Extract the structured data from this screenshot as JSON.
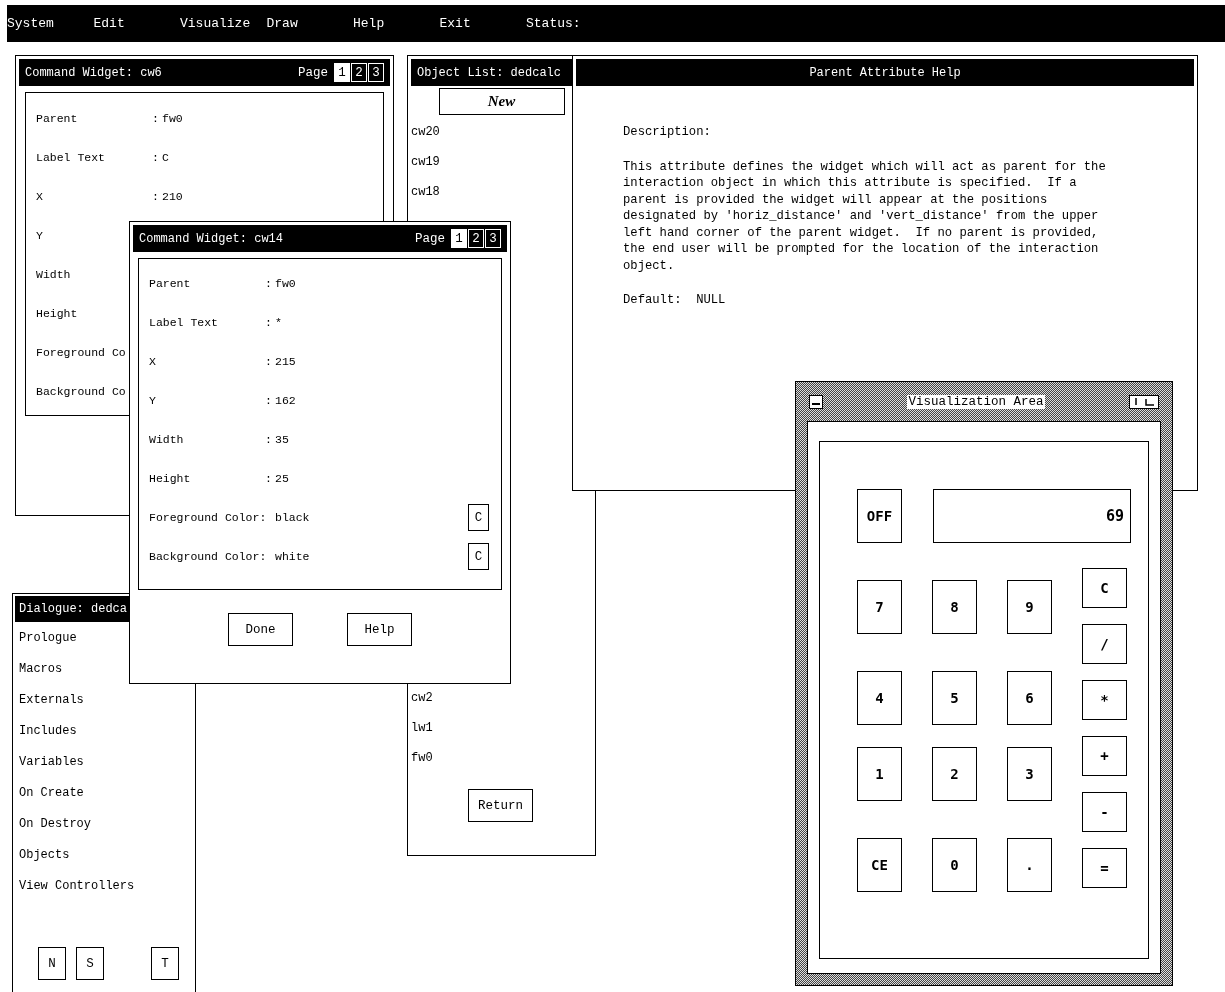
{
  "menu_bar": {
    "items": [
      "System",
      "Edit",
      "Visualize",
      "Draw",
      "Help",
      "Exit"
    ],
    "status_label": "Status:"
  },
  "command_widgets": [
    {
      "title": "Command Widget: cw6",
      "page_label": "Page",
      "pages": [
        {
          "label": "1",
          "selected": true
        },
        {
          "label": "2",
          "selected": false
        },
        {
          "label": "3",
          "selected": false
        }
      ],
      "fields": [
        {
          "label": "Parent",
          "separator": ":",
          "value": "fw0"
        },
        {
          "label": "Label Text",
          "separator": ":",
          "value": "C"
        },
        {
          "label": "X",
          "separator": ":",
          "value": "210"
        },
        {
          "label": "Y"
        },
        {
          "label": "Width"
        },
        {
          "label": "Height"
        },
        {
          "label": "Foreground Co"
        },
        {
          "label": "Background Co"
        }
      ]
    },
    {
      "title": "Command Widget: cw14",
      "page_label": "Page",
      "pages": [
        {
          "label": "1",
          "selected": true
        },
        {
          "label": "2",
          "selected": false
        },
        {
          "label": "3",
          "selected": false
        }
      ],
      "fields": [
        {
          "label": "Parent",
          "separator": ":",
          "value": "fw0"
        },
        {
          "label": "Label Text",
          "separator": ":",
          "value": "*"
        },
        {
          "label": "X",
          "separator": ":",
          "value": "215"
        },
        {
          "label": "Y",
          "separator": ":",
          "value": "162"
        },
        {
          "label": "Width",
          "separator": ":",
          "value": "35"
        },
        {
          "label": "Height",
          "separator": ":",
          "value": "25"
        },
        {
          "label": "Foreground Color:",
          "value": "black",
          "button": "C"
        },
        {
          "label": "Background Color:",
          "value": "white",
          "button": "C"
        }
      ],
      "buttons": [
        "Done",
        "Help"
      ]
    }
  ],
  "object_list": {
    "title": "Object List: dedcalc",
    "new_button": "New",
    "items_top": [
      "cw20",
      "cw19",
      "cw18"
    ],
    "items_bottom": [
      "cw2",
      "lw1",
      "fw0"
    ],
    "return_button": "Return"
  },
  "help": {
    "title": "Parent Attribute Help",
    "heading": "Description:",
    "body": "This attribute defines the widget which will act as parent for the\ninteraction object in which this attribute is specified.  If a\nparent is provided the widget will appear at the positions\ndesignated by 'horiz_distance' and 'vert_distance' from the upper\nleft hand corner of the parent widget.  If no parent is provided,\nthe end user will be prompted for the location of the interaction\nobject.",
    "default": "Default:  NULL"
  },
  "dialogue": {
    "title": "Dialogue: dedca",
    "items": [
      "Prologue",
      "Macros",
      "Externals",
      "Includes",
      "Variables",
      "On Create",
      "On Destroy",
      "Objects",
      "View Controllers"
    ],
    "buttons": [
      "N",
      "S",
      "T"
    ]
  },
  "calculator": {
    "title": "Visualization Area",
    "power": "OFF",
    "display": "69",
    "keys": [
      [
        "7",
        "8",
        "9"
      ],
      [
        "4",
        "5",
        "6"
      ],
      [
        "1",
        "2",
        "3"
      ],
      [
        "CE",
        "0",
        "."
      ]
    ],
    "operators": [
      "C",
      "/",
      "*",
      "+",
      "-",
      "="
    ]
  }
}
